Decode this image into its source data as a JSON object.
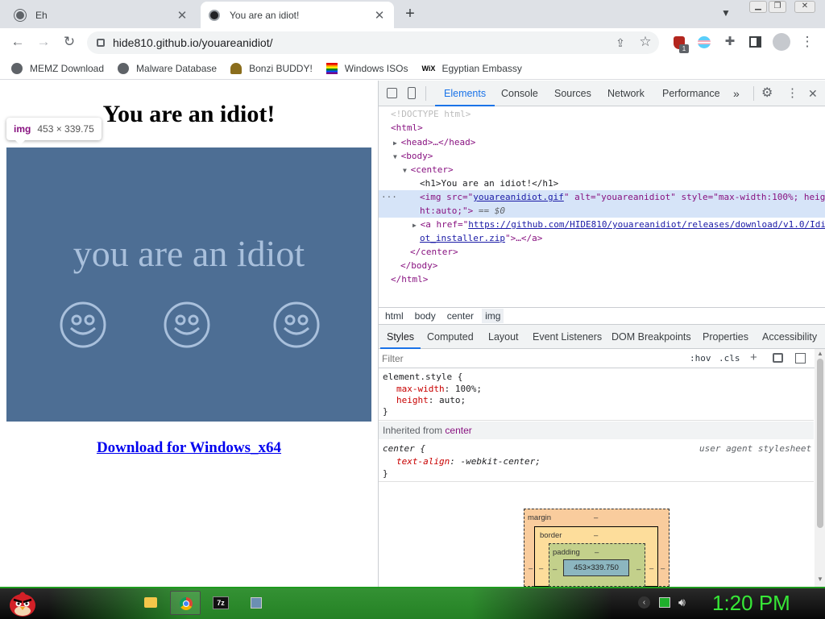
{
  "browser": {
    "tabs": [
      {
        "title": "Eh"
      },
      {
        "title": "You are an idiot!"
      }
    ],
    "url": "hide810.github.io/youareanidiot/",
    "extension_badge": "1",
    "bookmarks": [
      {
        "label": "MEMZ Download",
        "icon": "globe-icon"
      },
      {
        "label": "Malware Database",
        "icon": "globe-icon"
      },
      {
        "label": "Bonzi BUDDY!",
        "icon": "bonzi-icon"
      },
      {
        "label": "Windows ISOs",
        "icon": "rainbow-flag-icon"
      },
      {
        "label": "Egyptian Embassy",
        "icon": "wix-icon",
        "icon_text": "WiX"
      }
    ]
  },
  "page": {
    "heading": "You are an idiot!",
    "tooltip": {
      "tag": "img",
      "size": "453 × 339.75"
    },
    "image_text": "you are an idiot",
    "link": "Download for Windows_x64",
    "image_bg": "#4d6e94"
  },
  "devtools": {
    "tabs": [
      "Elements",
      "Console",
      "Sources",
      "Network",
      "Performance"
    ],
    "dom": {
      "doctype": "<!DOCTYPE html>",
      "html_open": "<html>",
      "head": "<head>…</head>",
      "body_open": "<body>",
      "center_open": "<center>",
      "h1_line": "<h1>You are an idiot!</h1>",
      "img_line1_a": "<img src=\"",
      "img_src": "youareanidiot.gif",
      "img_line1_b": "\" alt=\"youareanidiot\" style=\"max-width:100%; heig",
      "img_line2": "ht:auto;\">",
      "img_eq": " == $0",
      "a_line1_a": "<a href=\"",
      "a_href1": "https://github.com/HIDE810/youareanidiot/releases/download/v1.0/Idi",
      "a_href2": "ot_installer.zip",
      "a_line2_b": "\">…</a>",
      "center_close": "</center>",
      "body_close": "</body>",
      "html_close": "</html>"
    },
    "breadcrumbs": [
      "html",
      "body",
      "center",
      "img"
    ],
    "subtabs": [
      "Styles",
      "Computed",
      "Layout",
      "Event Listeners",
      "DOM Breakpoints",
      "Properties",
      "Accessibility"
    ],
    "filter_placeholder": "Filter",
    "hov": ":hov",
    "cls": ".cls",
    "element_style": {
      "selector": "element.style {",
      "props": [
        {
          "name": "max-width",
          "value": "100%;"
        },
        {
          "name": "height",
          "value": "auto;"
        }
      ],
      "close": "}"
    },
    "inherited_label": "Inherited from",
    "inherited_from": "center",
    "ua_rule": {
      "selector": "center {",
      "source": "user agent stylesheet",
      "prop": "text-align",
      "value": "-webkit-center;",
      "close": "}"
    },
    "box_model": {
      "margin": "margin",
      "border": "border",
      "padding": "padding",
      "dash": "–",
      "content": "453×339.750"
    }
  },
  "taskbar": {
    "time": "1:20 PM",
    "archive_label": "7z"
  }
}
